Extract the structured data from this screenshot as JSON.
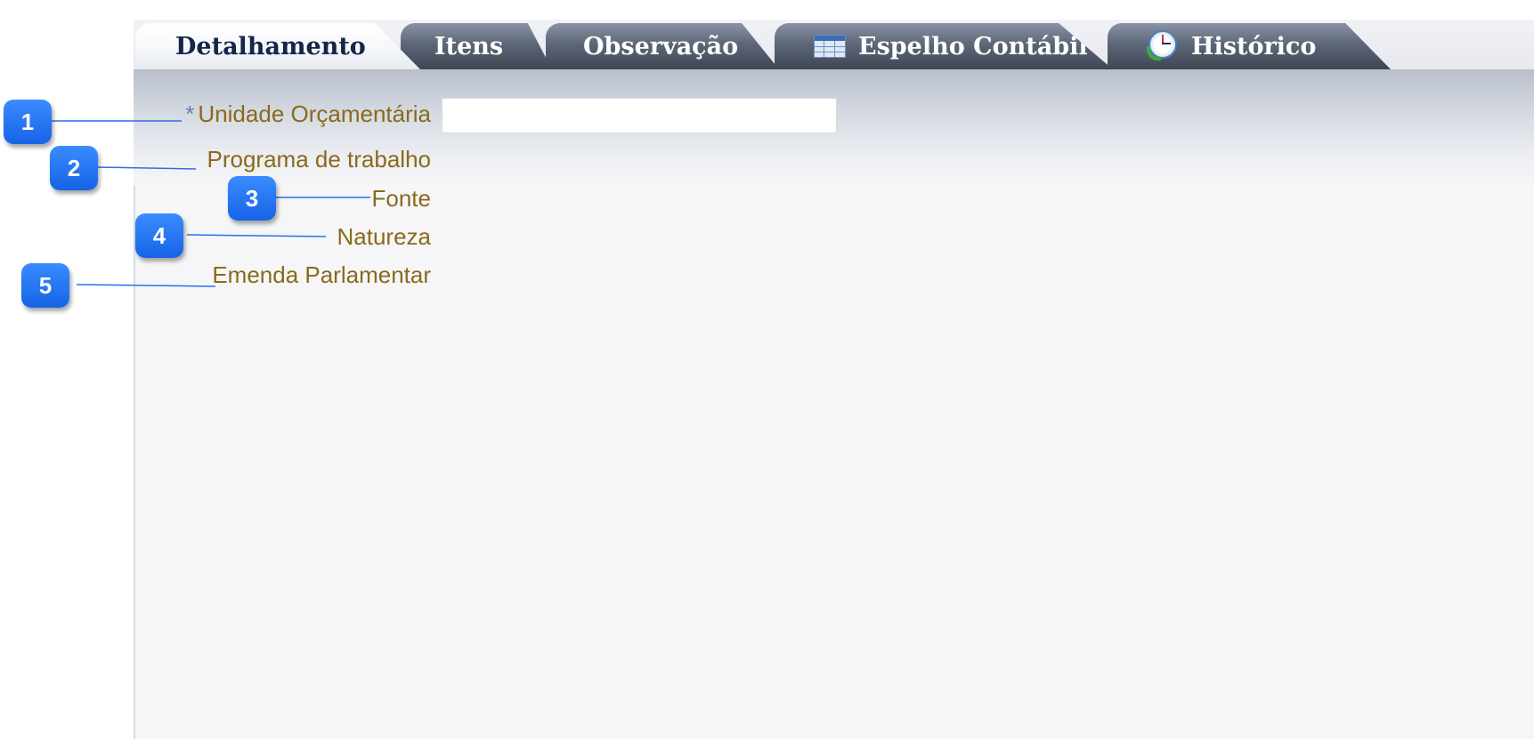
{
  "tabs": [
    {
      "label": "Detalhamento",
      "active": true,
      "icon": null
    },
    {
      "label": "Itens",
      "active": false,
      "icon": null
    },
    {
      "label": "Observação",
      "active": false,
      "icon": null
    },
    {
      "label": "Espelho Contábil",
      "active": false,
      "icon": "table-grid-icon"
    },
    {
      "label": "Histórico",
      "active": false,
      "icon": "clock-history-icon"
    }
  ],
  "form": {
    "required_mark": "*",
    "unidade_orcamentaria": {
      "label": "Unidade Orçamentária",
      "value": "",
      "required": true
    },
    "programa_trabalho": {
      "label": "Programa de trabalho"
    },
    "fonte": {
      "label": "Fonte"
    },
    "natureza": {
      "label": "Natureza"
    },
    "emenda_parlamentar": {
      "label": "Emenda Parlamentar"
    }
  },
  "callouts": [
    "1",
    "2",
    "3",
    "4",
    "5"
  ],
  "colors": {
    "callout": "#1f6ff2",
    "label_text": "#8a6a1a",
    "active_tab_text": "#15254a",
    "inactive_tab_bg": "#5e6778"
  }
}
